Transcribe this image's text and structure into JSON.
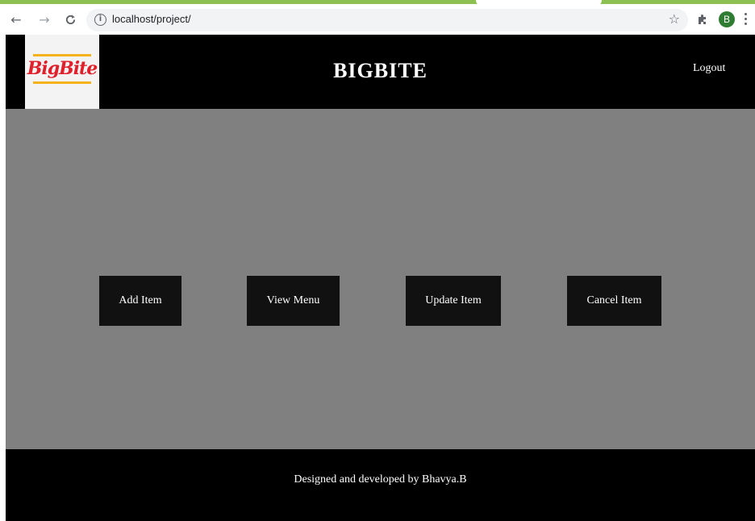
{
  "browser": {
    "url": "localhost/project/",
    "profile_initial": "B",
    "icons": {
      "back": "arrow-left-icon",
      "forward": "arrow-right-icon",
      "reload": "reload-icon",
      "info": "info-icon",
      "bookmark": "star-icon",
      "extensions": "puzzle-icon",
      "menu": "kebab-menu-icon"
    },
    "colors": {
      "tab_accent": "#8cc152",
      "profile_avatar": "#2e7d32"
    }
  },
  "header": {
    "logo_text": "BigBite",
    "title": "BIGBITE",
    "logout_label": "Logout",
    "colors": {
      "background": "#000000",
      "logo_red": "#e0202a",
      "logo_yellow": "#f5b21b"
    }
  },
  "main": {
    "background": "#808080",
    "actions": [
      {
        "label": "Add Item"
      },
      {
        "label": "View Menu"
      },
      {
        "label": "Update Item"
      },
      {
        "label": "Cancel Item"
      }
    ]
  },
  "footer": {
    "text": "Designed and developed by Bhavya.B"
  }
}
